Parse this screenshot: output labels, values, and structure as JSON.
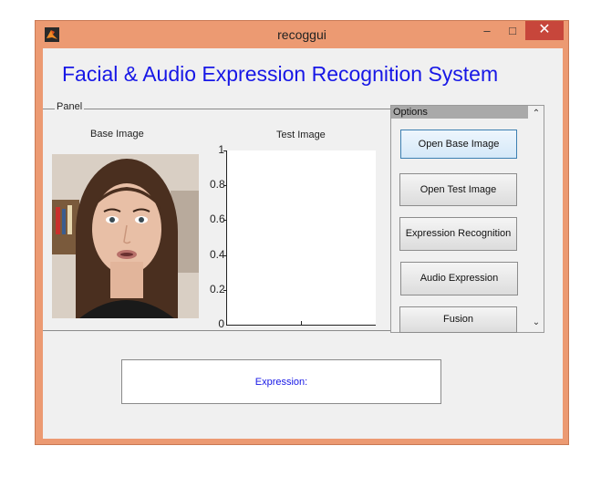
{
  "window": {
    "title": "recoggui",
    "minimize": "–",
    "maximize": "□",
    "close": "✕"
  },
  "heading": "Facial & Audio Expression Recognition System",
  "panel": {
    "label": "Panel",
    "base_image_label": "Base Image",
    "test_image_label": "Test Image",
    "axes": {
      "y_ticks": [
        "1",
        "0.8",
        "0.6",
        "0.4",
        "0.2",
        "0"
      ]
    }
  },
  "options": {
    "title": "Options",
    "buttons": [
      {
        "label": "Open Base Image"
      },
      {
        "label": "Open Test Image"
      },
      {
        "label": "Expression Recognition"
      },
      {
        "label": "Audio Expression"
      },
      {
        "label": "Fusion"
      }
    ]
  },
  "expression": {
    "label": "Expression:"
  },
  "colors": {
    "title_blue": "#1717e6",
    "window_frame": "#ec9a72",
    "close_red": "#c7463b"
  }
}
